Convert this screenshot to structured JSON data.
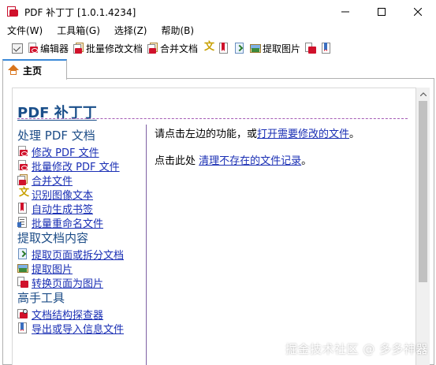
{
  "window": {
    "title": "PDF 补丁丁 [1.0.1.4234]",
    "controls": [
      "minimize",
      "maximize",
      "close"
    ]
  },
  "menu": {
    "items": [
      {
        "label": "文件(W)"
      },
      {
        "label": "工具箱(G)"
      },
      {
        "label": "选择(Z)"
      },
      {
        "label": "帮助(B)"
      }
    ]
  },
  "toolbar": {
    "editor_label": "编辑器",
    "batch_edit_label": "批量修改文档",
    "merge_label": "合并文档",
    "extract_images_label": "提取图片"
  },
  "tab": {
    "home_label": "主页"
  },
  "doc": {
    "title": "PDF 补丁丁",
    "sections": [
      {
        "heading": "处理 PDF 文档",
        "links": [
          {
            "label": "修改 PDF 文件",
            "icon": "pdf-icon"
          },
          {
            "label": "批量修改 PDF 文件",
            "icon": "batch-pdf-icon"
          },
          {
            "label": "合并文件",
            "icon": "merge-icon"
          },
          {
            "label": "识别图像文本",
            "icon": "ocr-icon"
          },
          {
            "label": "自动生成书签",
            "icon": "bookmark-icon"
          },
          {
            "label": "批量重命名文件",
            "icon": "rename-icon"
          }
        ]
      },
      {
        "heading": "提取文档内容",
        "links": [
          {
            "label": "提取页面或拆分文档",
            "icon": "extract-pages-icon"
          },
          {
            "label": "提取图片",
            "icon": "image-icon"
          },
          {
            "label": "转换页面为图片",
            "icon": "convert-icon"
          }
        ]
      },
      {
        "heading": "高手工具",
        "links": [
          {
            "label": "文档结构探查器",
            "icon": "structure-icon"
          },
          {
            "label": "导出或导入信息文件",
            "icon": "info-file-icon"
          }
        ]
      }
    ],
    "right": {
      "line1_prefix": "请点击左边的功能，或",
      "line1_link": "打开需要修改的文件",
      "line1_suffix": "。",
      "line2_prefix": "点击此处 ",
      "line2_link": "清理不存在的文件记录",
      "line2_suffix": "。"
    }
  },
  "watermark": "掘金技术社区 @ 多多神器",
  "colors": {
    "link": "#1a2fb4",
    "heading": "#1d4d87",
    "tab_accent": "#3a88d8",
    "pdf_red": "#d0112b"
  }
}
